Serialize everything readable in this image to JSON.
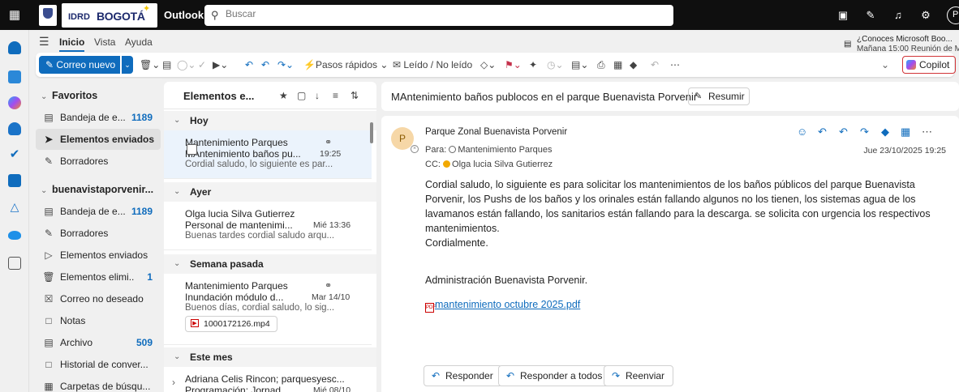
{
  "topbar": {
    "apps_icon": "grid-icon",
    "logo_idrd": "IDRD",
    "logo_bogota": "BOGOTÁ",
    "app_name": "Outlook",
    "search_placeholder": "Buscar",
    "avatar_initial": "P"
  },
  "ribbon": {
    "tabs": [
      "Inicio",
      "Vista",
      "Ayuda"
    ],
    "active_tab": "Inicio",
    "notification": {
      "line1": "¿Conoces Microsoft Boo...",
      "line2": "Mañana 15:00 Reunión de M..."
    },
    "new_mail": "Correo nuevo",
    "quick_steps": "Pasos rápidos",
    "read_unread": "Leído / No leído",
    "copilot": "Copilot"
  },
  "folders": {
    "favorites_header": "Favoritos",
    "favorites": [
      {
        "label": "Bandeja de e...",
        "count": "1189",
        "icon": "inbox-icon"
      },
      {
        "label": "Elementos enviados",
        "count": "",
        "icon": "send-icon",
        "selected": true
      },
      {
        "label": "Borradores",
        "count": "",
        "icon": "draft-icon"
      }
    ],
    "account_header": "buenavistaporvenir...",
    "account": [
      {
        "label": "Bandeja de e...",
        "count": "1189",
        "icon": "inbox-icon"
      },
      {
        "label": "Borradores",
        "count": "",
        "icon": "draft-icon"
      },
      {
        "label": "Elementos enviados",
        "count": "",
        "icon": "send-icon"
      },
      {
        "label": "Elementos elimi...",
        "count": "1",
        "icon": "trash-icon"
      },
      {
        "label": "Correo no deseado",
        "count": "",
        "icon": "junk-icon"
      },
      {
        "label": "Notas",
        "count": "",
        "icon": "note-icon"
      },
      {
        "label": "Archivo",
        "count": "509",
        "icon": "archive-icon"
      },
      {
        "label": "Historial de conver...",
        "count": "",
        "icon": "folder-icon"
      },
      {
        "label": "Carpetas de búsqu...",
        "count": "",
        "icon": "search-folder-icon"
      }
    ]
  },
  "list": {
    "title": "Elementos e...",
    "groups": [
      "Hoy",
      "Ayer",
      "Semana pasada",
      "Este mes"
    ],
    "mails": [
      {
        "sender": "Mantenimiento Parques",
        "subject": "MAntenimiento baños pu...",
        "time": "19:25",
        "preview": "Cordial saludo, lo siguiente es par..."
      },
      {
        "sender": "Olga lucia Silva Gutierrez",
        "subject": "Personal de mantenimi...",
        "time": "Mié 13:36",
        "preview": "Buenas tardes cordial saludo arqu..."
      },
      {
        "sender": "Mantenimiento Parques",
        "subject": "Inundación módulo d...",
        "time": "Mar 14/10",
        "preview": "Buenos días, cordial saludo, lo sig...",
        "attachment": "1000172126.mp4"
      },
      {
        "sender": "Adriana Celis Rincon; parquesyesc...",
        "subject": "Programación: Jornad...",
        "time": "Mié 08/10",
        "preview": ""
      }
    ]
  },
  "reading": {
    "subject": "MAntenimiento baños publocos en el parque Buenavista Porvenir",
    "summarize": "Resumir",
    "avatar": "P",
    "from": "Parque Zonal Buenavista Porvenir",
    "to_label": "Para:",
    "to": "Mantenimiento Parques",
    "cc_label": "CC:",
    "cc": "Olga lucia Silva Gutierrez",
    "date": "Jue 23/10/2025 19:25",
    "body": "Cordial saludo, lo siguiente es para solicitar los mantenimientos de los baños públicos del parque Buenavista Porvenir, los Pushs de los baños y los orinales están fallando algunos no los tienen, los sistemas agua de los lavamanos están fallando, los sanitarios están fallando para la descarga. se solicita con urgencia los respectivos mantenimientos.",
    "closing": "Cordialmente.",
    "signature": "Administración Buenavista Porvenir.",
    "attachment": "mantenimiento octubre 2025.pdf",
    "reply": "Responder",
    "reply_all": "Responder a todos",
    "forward": "Reenviar"
  },
  "colors": {
    "accent": "#0f6cbd",
    "topbar": "#0f0f0f",
    "selected_mail": "#ebf3fc"
  }
}
